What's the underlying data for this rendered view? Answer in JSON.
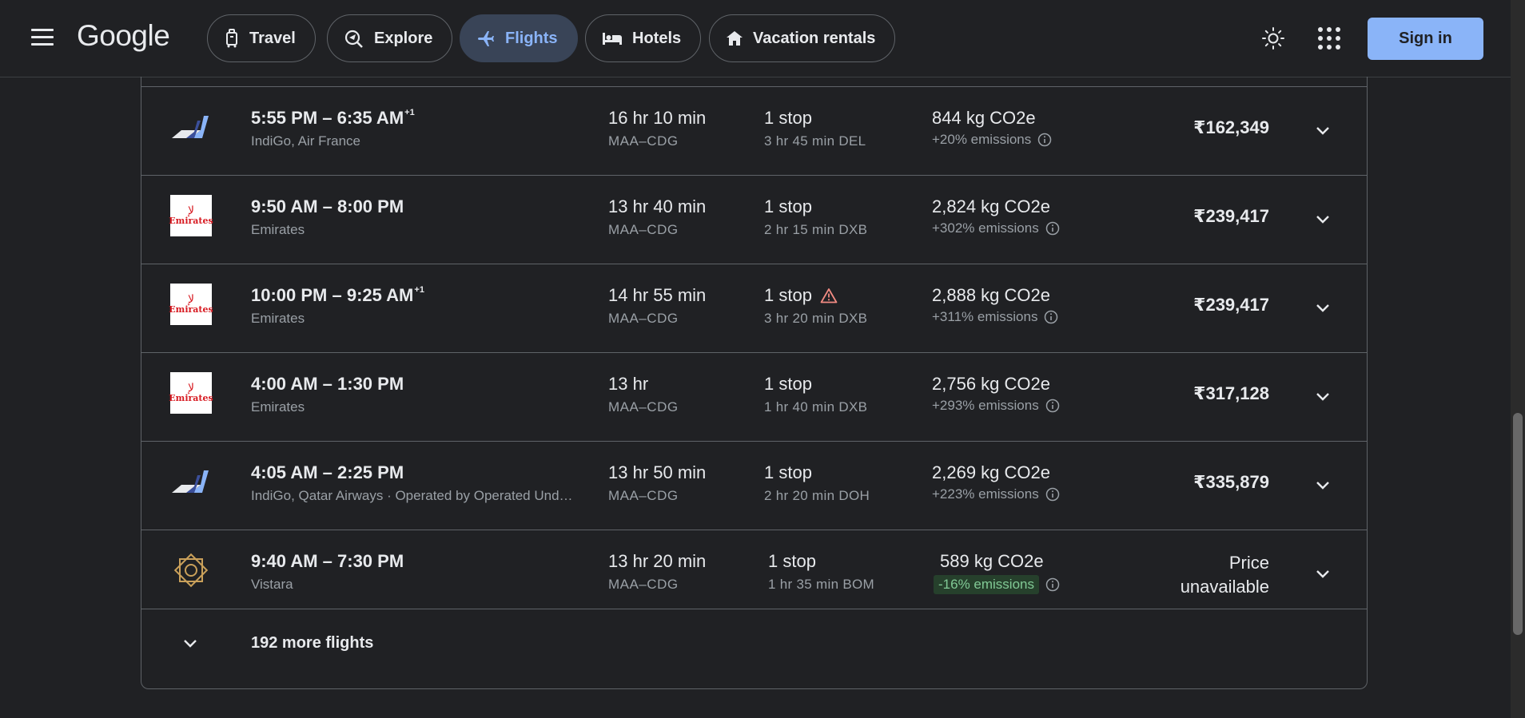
{
  "header": {
    "logo": "Google",
    "tabs": [
      {
        "label": "Travel",
        "icon": "luggage-icon"
      },
      {
        "label": "Explore",
        "icon": "explore-icon"
      },
      {
        "label": "Flights",
        "icon": "flight-icon",
        "active": true
      },
      {
        "label": "Hotels",
        "icon": "hotel-icon"
      },
      {
        "label": "Vacation rentals",
        "icon": "home-icon"
      }
    ],
    "sign_in": "Sign in"
  },
  "flights": [
    {
      "logo": "indigo-air-france-logo",
      "time": "5:55 PM – 6:35 AM",
      "day_offset": "+1",
      "airline": "IndiGo, Air France",
      "duration": "16 hr 10 min",
      "route": "MAA–CDG",
      "stops": "1 stop",
      "layover": "3 hr 45 min DEL",
      "co2": "844 kg CO2e",
      "emissions": "+20% emissions",
      "price": "₹162,349"
    },
    {
      "logo": "emirates-logo",
      "time": "9:50 AM – 8:00 PM",
      "day_offset": "",
      "airline": "Emirates",
      "duration": "13 hr 40 min",
      "route": "MAA–CDG",
      "stops": "1 stop",
      "layover": "2 hr 15 min DXB",
      "co2": "2,824 kg CO2e",
      "emissions": "+302% emissions",
      "price": "₹239,417"
    },
    {
      "logo": "emirates-logo",
      "time": "10:00 PM – 9:25 AM",
      "day_offset": "+1",
      "airline": "Emirates",
      "duration": "14 hr 55 min",
      "route": "MAA–CDG",
      "stops": "1 stop",
      "warning": true,
      "layover": "3 hr 20 min DXB",
      "co2": "2,888 kg CO2e",
      "emissions": "+311% emissions",
      "price": "₹239,417"
    },
    {
      "logo": "emirates-logo",
      "time": "4:00 AM – 1:30 PM",
      "day_offset": "",
      "airline": "Emirates",
      "duration": "13 hr",
      "route": "MAA–CDG",
      "stops": "1 stop",
      "layover": "1 hr 40 min DXB",
      "co2": "2,756 kg CO2e",
      "emissions": "+293% emissions",
      "price": "₹317,128"
    },
    {
      "logo": "indigo-qatar-logo",
      "time": "4:05 AM – 2:25 PM",
      "day_offset": "",
      "airline": "IndiGo, Qatar Airways · Operated by Operated Und…",
      "duration": "13 hr 50 min",
      "route": "MAA–CDG",
      "stops": "1 stop",
      "layover": "2 hr 20 min DOH",
      "co2": "2,269 kg CO2e",
      "emissions": "+223% emissions",
      "price": "₹335,879"
    },
    {
      "logo": "vistara-logo",
      "time": "9:40 AM – 7:30 PM",
      "day_offset": "",
      "airline": "Vistara",
      "duration": "13 hr 20 min",
      "route": "MAA–CDG",
      "stops": "1 stop",
      "layover": "1 hr 35 min BOM",
      "co2": "589 kg CO2e",
      "emissions": "-16% emissions",
      "emissions_low": true,
      "price_line1": "Price",
      "price_line2": "unavailable"
    }
  ],
  "emirates_logo_text": "Emirates",
  "more_flights": "192 more flights",
  "colors": {
    "background": "#202124",
    "accent": "#8ab4f8",
    "active_chip": "#394457",
    "low_emission_bg": "#26402c",
    "low_emission_text": "#81c995",
    "warning": "#f28b82"
  }
}
